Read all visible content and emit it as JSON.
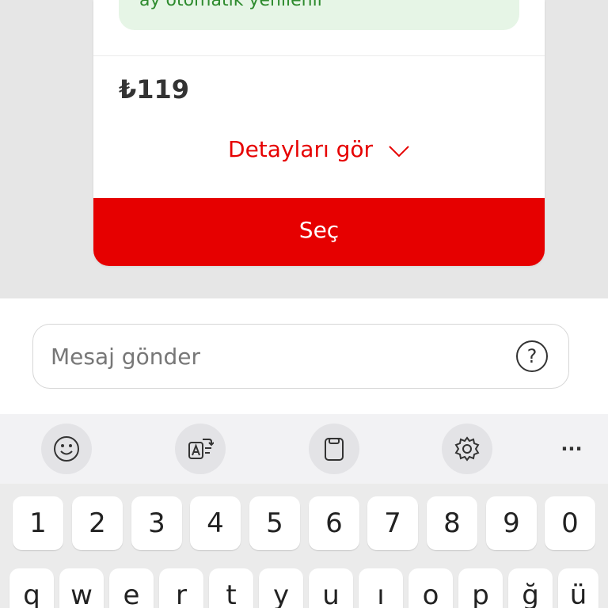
{
  "card": {
    "info_text": "ay otomatik yenilenir",
    "price": "₺119",
    "details_label": "Detayları gör",
    "select_label": "Seç"
  },
  "composer": {
    "placeholder": "Mesaj gönder",
    "help_label": "?"
  },
  "keyboard": {
    "toolbar": [
      "emoji-icon",
      "translate-icon",
      "clipboard-icon",
      "settings-icon",
      "more-icon"
    ],
    "more_label": "···",
    "number_row": [
      "1",
      "2",
      "3",
      "4",
      "5",
      "6",
      "7",
      "8",
      "9",
      "0"
    ],
    "letter_row": [
      "q",
      "w",
      "e",
      "r",
      "t",
      "y",
      "u",
      "ı",
      "o",
      "p",
      "ğ",
      "ü"
    ]
  },
  "colors": {
    "accent": "#e60000",
    "info_bg": "#e6f5e6",
    "info_text": "#2e8b2e"
  }
}
